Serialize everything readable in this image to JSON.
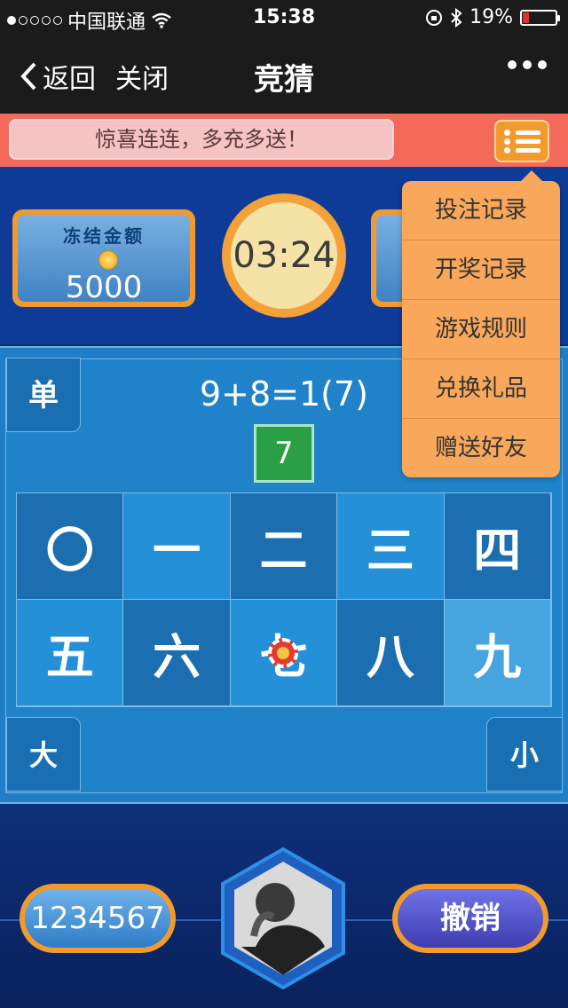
{
  "status_bar": {
    "carrier": "中国联通",
    "time": "15:38",
    "battery": "19%",
    "battery_level": 0.19
  },
  "nav": {
    "back": "返回",
    "close": "关闭",
    "title": "竞猜"
  },
  "promo": {
    "text": "惊喜连连，多充多送！"
  },
  "frozen_amount": {
    "label": "冻结金额",
    "value": "5000"
  },
  "timer": "03:24",
  "board": {
    "single_label": "单",
    "equation": "9+8=1(7)",
    "answer": "7",
    "cells": [
      "〇",
      "一",
      "二",
      "三",
      "四",
      "五",
      "六",
      "七",
      "八",
      "九"
    ],
    "big_label": "大",
    "small_label": "小"
  },
  "bottom": {
    "balance": "1234567",
    "cancel": "撤销"
  },
  "menu": {
    "items": [
      "投注记录",
      "开奖记录",
      "游戏规则",
      "兑换礼品",
      "赠送好友"
    ]
  },
  "colors": {
    "accent_orange": "#f39a2d",
    "board_blue": "#1f7ec6",
    "answer_green": "#2aa045"
  }
}
